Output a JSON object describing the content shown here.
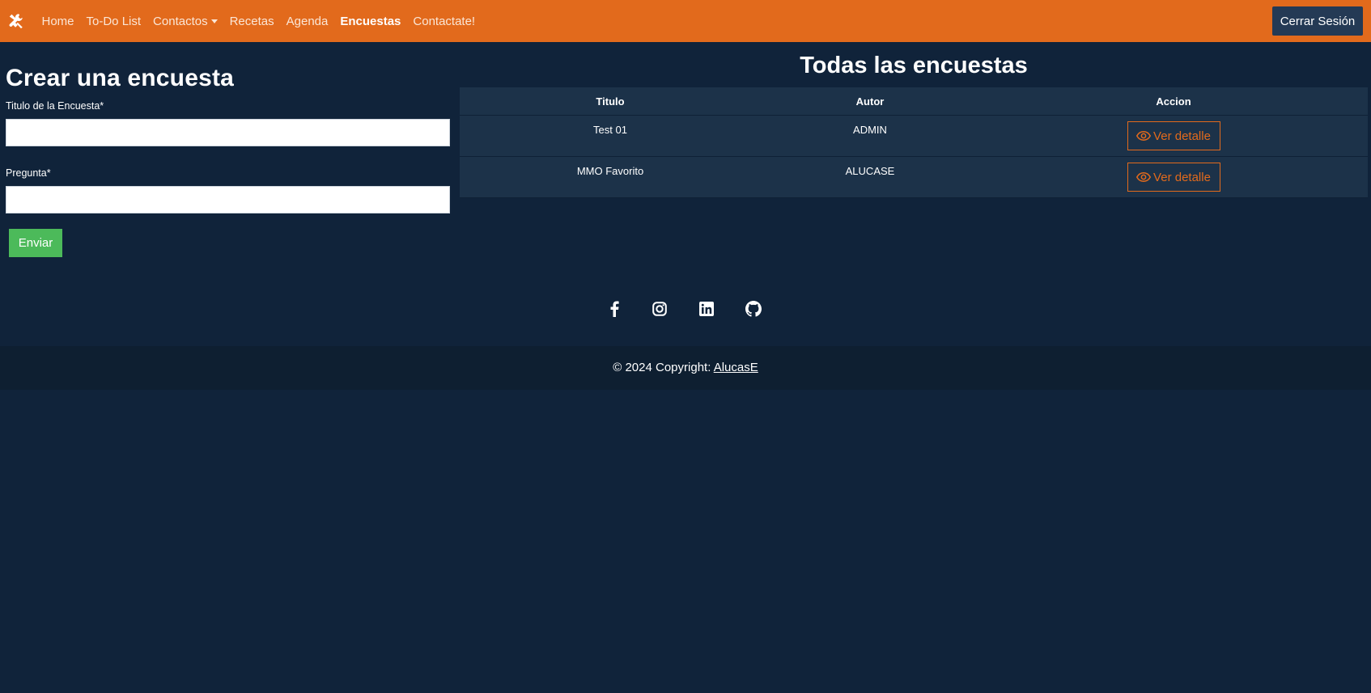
{
  "navbar": {
    "brand_icon": "tools-icon",
    "items": [
      {
        "label": "Home"
      },
      {
        "label": "To-Do List"
      },
      {
        "label": "Contactos"
      },
      {
        "label": "Recetas"
      },
      {
        "label": "Agenda"
      },
      {
        "label": "Encuestas"
      },
      {
        "label": "Contactate!"
      }
    ],
    "logout_label": "Cerrar Sesión",
    "color": "#e26a1c"
  },
  "form": {
    "title": "Crear una encuesta",
    "title_label": "Titulo de la Encuesta*",
    "title_value": "",
    "question_label": "Pregunta*",
    "question_value": "",
    "submit_label": "Enviar"
  },
  "surveys": {
    "title": "Todas las encuestas",
    "columns": [
      "Titulo",
      "Autor",
      "Accion"
    ],
    "rows": [
      {
        "titulo": "Test 01",
        "autor": "ADMIN",
        "action": "Ver detalle"
      },
      {
        "titulo": "MMO Favorito",
        "autor": "ALUCASE",
        "action": "Ver detalle"
      }
    ]
  },
  "social": [
    "facebook-icon",
    "instagram-icon",
    "linkedin-icon",
    "github-icon"
  ],
  "footer": {
    "copyright_text": "© 2024 Copyright: ",
    "copyright_link": "AlucasE"
  },
  "colors": {
    "background": "#10233a",
    "accent": "#e26a1c",
    "success": "#4cba5a"
  }
}
